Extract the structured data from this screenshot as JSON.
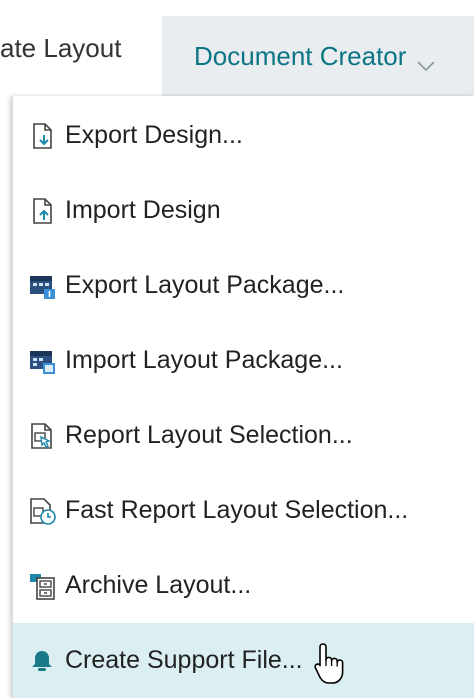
{
  "menubar": {
    "previous_tab_label": "ate Layout",
    "active_tab_label": "Document Creator"
  },
  "dropdown": {
    "items": [
      {
        "label": "Export Design...",
        "icon": "export-design-icon"
      },
      {
        "label": "Import Design",
        "icon": "import-design-icon"
      },
      {
        "label": "Export Layout Package...",
        "icon": "export-package-icon"
      },
      {
        "label": "Import Layout Package...",
        "icon": "import-package-icon"
      },
      {
        "label": "Report Layout Selection...",
        "icon": "report-layout-icon"
      },
      {
        "label": "Fast Report Layout Selection...",
        "icon": "fast-report-layout-icon"
      },
      {
        "label": "Archive Layout...",
        "icon": "archive-icon"
      },
      {
        "label": "Create Support File...",
        "icon": "bell-icon"
      }
    ]
  },
  "colors": {
    "accent": "#0b7586",
    "active_tab_bg": "#e9edef",
    "hover_bg": "#dbeff3"
  }
}
